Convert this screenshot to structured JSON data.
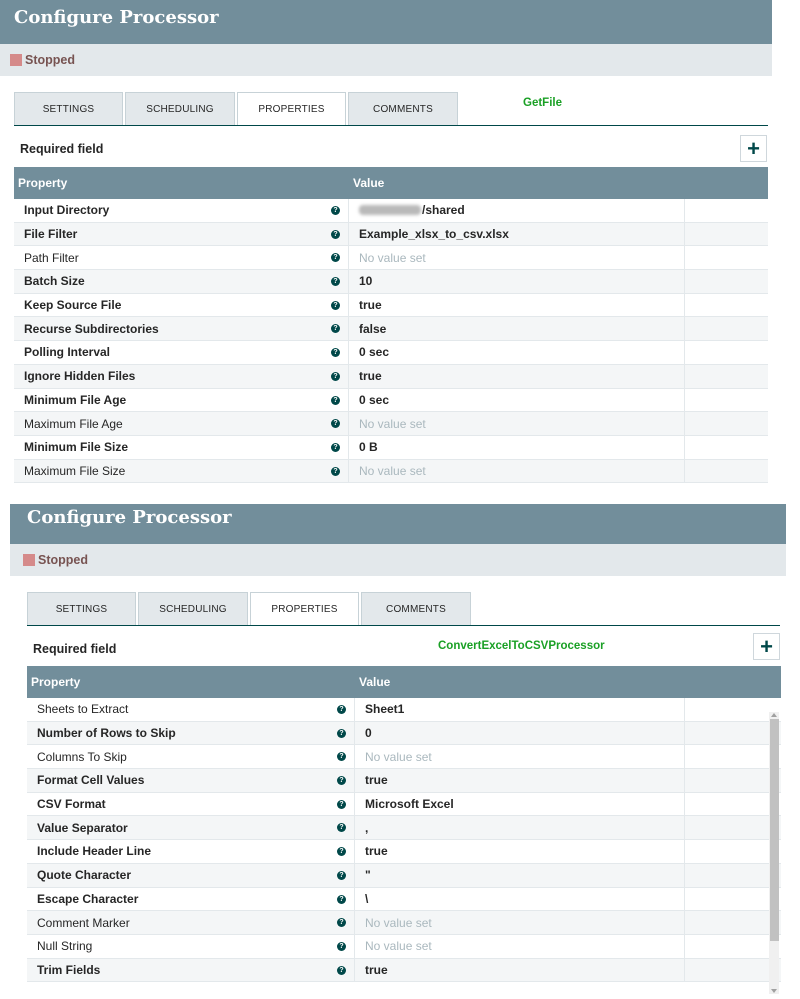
{
  "panel1": {
    "title": "Configure Processor",
    "status": "Stopped",
    "tabs": [
      "SETTINGS",
      "SCHEDULING",
      "PROPERTIES",
      "COMMENTS"
    ],
    "active_tab": "PROPERTIES",
    "processor_name": "GetFile",
    "required_label": "Required field",
    "add_label": "+",
    "header": {
      "property": "Property",
      "value": "Value"
    },
    "rows": [
      {
        "name": "Input Directory",
        "value": "/shared",
        "required": true,
        "set": true,
        "redacted": true
      },
      {
        "name": "File Filter",
        "value": "Example_xlsx_to_csv.xlsx",
        "required": true,
        "set": true
      },
      {
        "name": "Path Filter",
        "value": "No value set",
        "required": false,
        "set": false
      },
      {
        "name": "Batch Size",
        "value": "10",
        "required": true,
        "set": true
      },
      {
        "name": "Keep Source File",
        "value": "true",
        "required": true,
        "set": true
      },
      {
        "name": "Recurse Subdirectories",
        "value": "false",
        "required": true,
        "set": true
      },
      {
        "name": "Polling Interval",
        "value": "0 sec",
        "required": true,
        "set": true
      },
      {
        "name": "Ignore Hidden Files",
        "value": "true",
        "required": true,
        "set": true
      },
      {
        "name": "Minimum File Age",
        "value": "0 sec",
        "required": true,
        "set": true
      },
      {
        "name": "Maximum File Age",
        "value": "No value set",
        "required": false,
        "set": false
      },
      {
        "name": "Minimum File Size",
        "value": "0 B",
        "required": true,
        "set": true
      },
      {
        "name": "Maximum File Size",
        "value": "No value set",
        "required": false,
        "set": false
      }
    ]
  },
  "panel2": {
    "title": "Configure Processor",
    "status": "Stopped",
    "tabs": [
      "SETTINGS",
      "SCHEDULING",
      "PROPERTIES",
      "COMMENTS"
    ],
    "active_tab": "PROPERTIES",
    "processor_name": "ConvertExcelToCSVProcessor",
    "required_label": "Required field",
    "add_label": "+",
    "header": {
      "property": "Property",
      "value": "Value"
    },
    "rows": [
      {
        "name": "Sheets to Extract",
        "value": "Sheet1",
        "required": false,
        "set": true
      },
      {
        "name": "Number of Rows to Skip",
        "value": "0",
        "required": true,
        "set": true
      },
      {
        "name": "Columns To Skip",
        "value": "No value set",
        "required": false,
        "set": false
      },
      {
        "name": "Format Cell Values",
        "value": "true",
        "required": true,
        "set": true
      },
      {
        "name": "CSV Format",
        "value": "Microsoft Excel",
        "required": true,
        "set": true
      },
      {
        "name": "Value Separator",
        "value": ",",
        "required": true,
        "set": true
      },
      {
        "name": "Include Header Line",
        "value": "true",
        "required": true,
        "set": true
      },
      {
        "name": "Quote Character",
        "value": "\"",
        "required": true,
        "set": true
      },
      {
        "name": "Escape Character",
        "value": "\\",
        "required": true,
        "set": true
      },
      {
        "name": "Comment Marker",
        "value": "No value set",
        "required": false,
        "set": false
      },
      {
        "name": "Null String",
        "value": "No value set",
        "required": false,
        "set": false
      },
      {
        "name": "Trim Fields",
        "value": "true",
        "required": true,
        "set": true
      }
    ]
  },
  "colors": {
    "titlebar": "#728e9b",
    "status_bar": "#e3e8eb",
    "stopped": "#d58a8a",
    "processor_name": "#1aa025",
    "accent": "#004849",
    "empty_value": "#aab8be"
  },
  "icons": {
    "help": "question-circle-icon",
    "add": "plus-icon",
    "status": "stopped-square-icon"
  }
}
